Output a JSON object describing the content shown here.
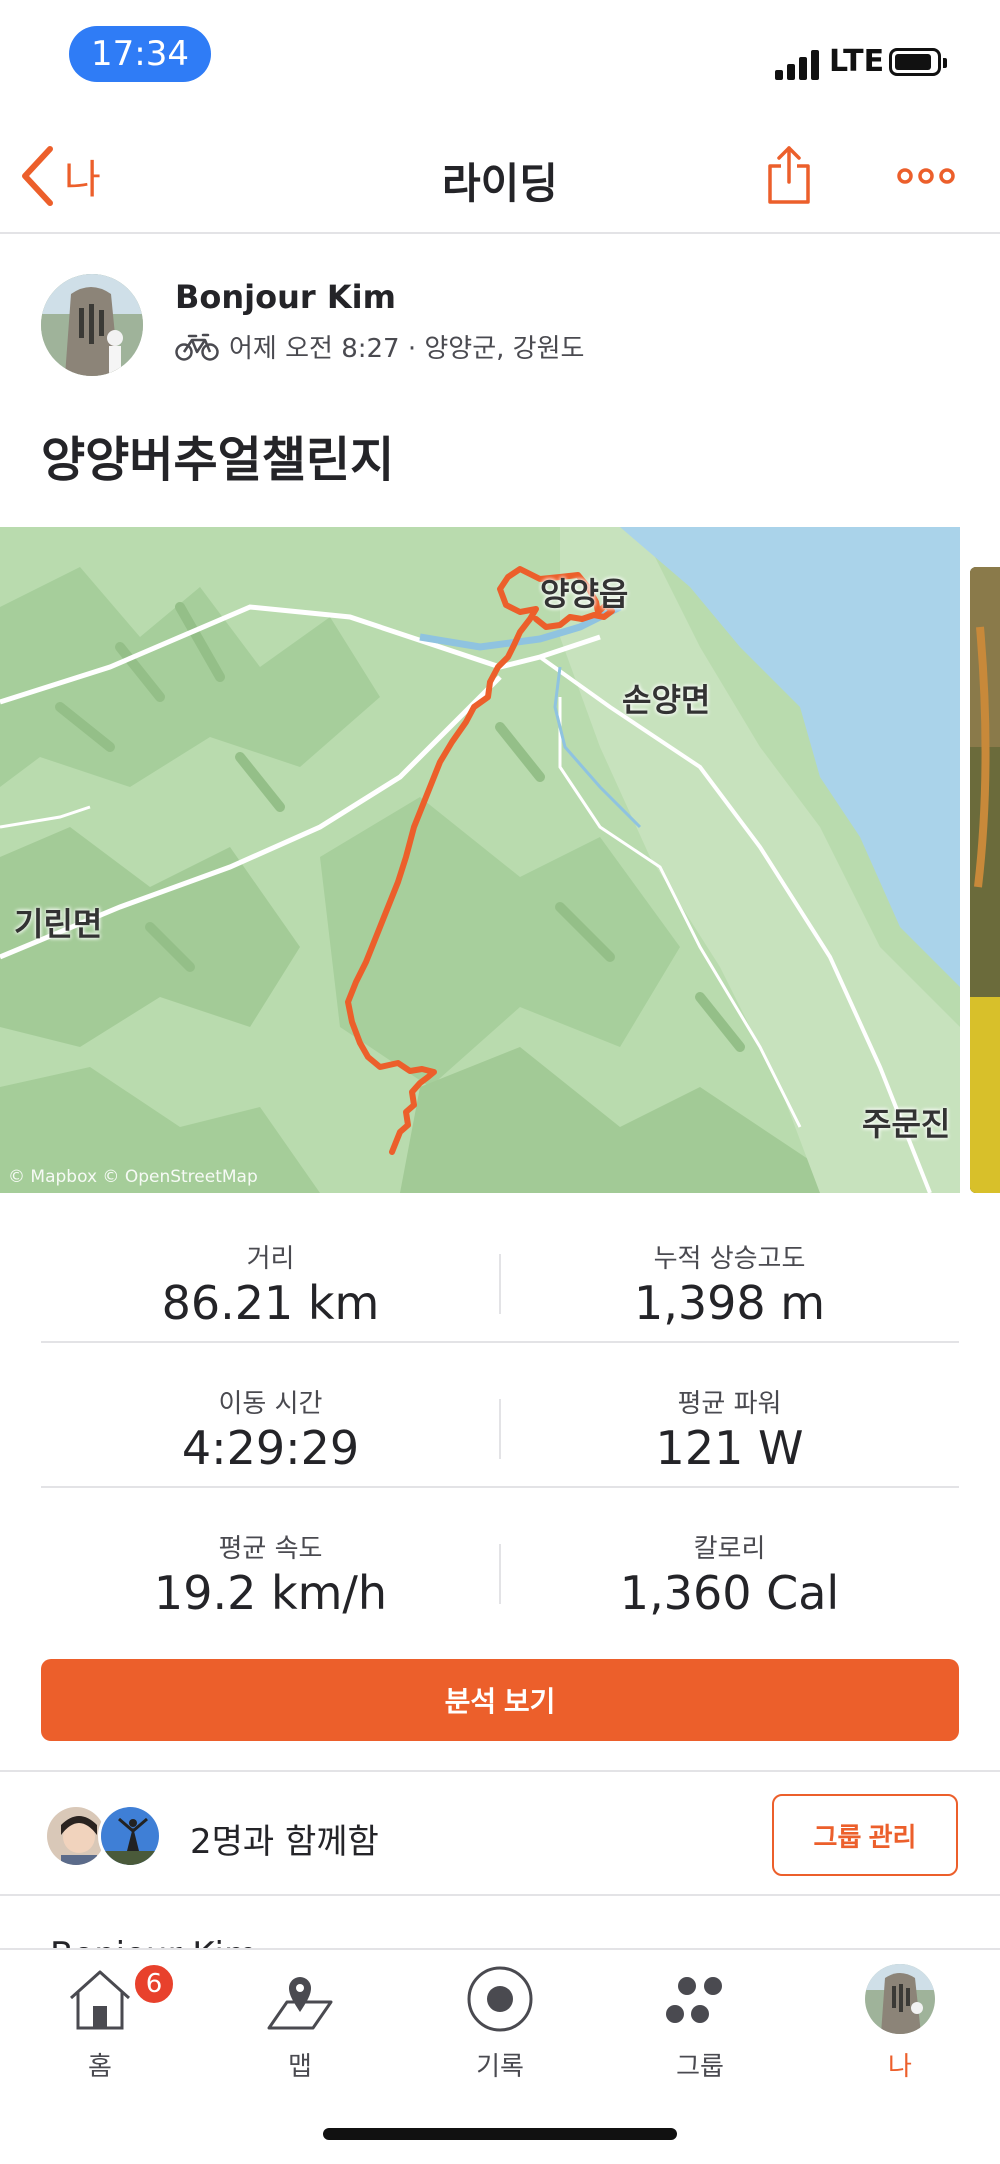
{
  "status_bar": {
    "time": "17:34",
    "network": "LTE"
  },
  "nav": {
    "back_label": "나",
    "title": "라이딩"
  },
  "athlete": {
    "name": "Bonjour Kim",
    "meta": "어제 오전 8:27 · 양양군, 강원도"
  },
  "activity": {
    "title": "양양버추얼챌린지"
  },
  "map": {
    "labels": {
      "town": "양양읍",
      "east": "손양면",
      "west": "기린면",
      "south": "주문진"
    },
    "attribution": "© Mapbox © OpenStreetMap",
    "route_color": "#ec5f2b"
  },
  "stats": [
    {
      "label": "거리",
      "value": "86.21 km"
    },
    {
      "label": "누적 상승고도",
      "value": "1,398 m"
    },
    {
      "label": "이동 시간",
      "value": "4:29:29"
    },
    {
      "label": "평균 파워",
      "value": "121 W"
    },
    {
      "label": "평균 속도",
      "value": "19.2 km/h"
    },
    {
      "label": "칼로리",
      "value": "1,360 Cal"
    }
  ],
  "analysis_button": "분석 보기",
  "group": {
    "text": "2명과 함께함",
    "manage_button": "그룹 관리"
  },
  "peek_text": "Bonjour Kim",
  "tabs": [
    {
      "label": "홈",
      "badge": "6",
      "icon": "home-icon"
    },
    {
      "label": "맵",
      "icon": "map-icon"
    },
    {
      "label": "기록",
      "icon": "record-icon"
    },
    {
      "label": "그룹",
      "icon": "groups-icon"
    },
    {
      "label": "나",
      "icon": "profile-avatar",
      "active": true
    }
  ],
  "colors": {
    "accent": "#ec5f2b",
    "status_pill": "#2f7cf6",
    "badge": "#e8412c"
  }
}
